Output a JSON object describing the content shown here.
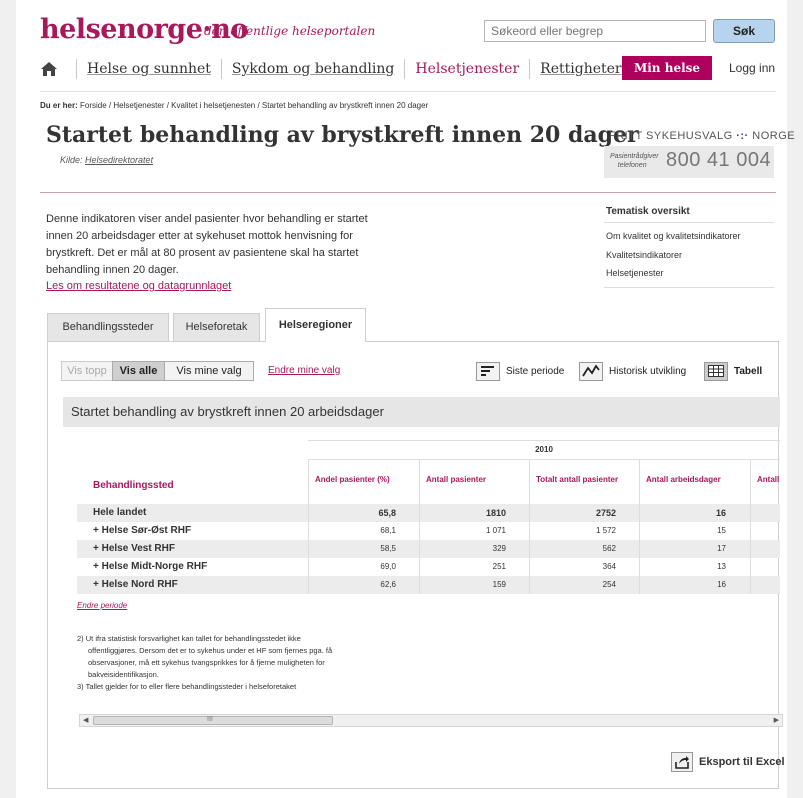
{
  "site": {
    "logo_main": "helsenorge",
    "logo_dot": "·",
    "logo_suffix": "no",
    "tagline": "den offentlige helseportalen",
    "search_placeholder": "Søkeord eller begrep",
    "search_button": "Søk"
  },
  "nav": {
    "items": [
      "Helse og sunnhet",
      "Sykdom og behandling",
      "Helsetjenester",
      "Rettigheter"
    ],
    "active_index": 2,
    "min_helse": "Min helse",
    "logg_inn": "Logg inn"
  },
  "breadcrumb": {
    "prefix": "Du er her:",
    "path": "Forside / Helsetjenester / Kvalitet i helsetjenesten / Startet behandling av brystkreft innen 20 dager"
  },
  "page": {
    "title": "Startet behandling av brystkreft innen 20 dager",
    "kilde_label": "Kilde:",
    "kilde_link": "Helsedirektoratet",
    "intro": "Denne indikatoren viser andel pasienter hvor behandling er startet innen 20 arbeidsdager etter at sykehuset mottok henvisning for brystkreft. Det er mål at 80 prosent av pasientene skal ha startet behandling innen 20 dager.",
    "intro_link": "Les om resultatene og datagrunnlaget"
  },
  "fritt_sykehusvalg": {
    "title": "FRITT SYKEHUSVALG",
    "country": "NORGE",
    "small_line1": "Pasientrådgiver",
    "small_line2": "telefonen",
    "number": "800 41 004"
  },
  "tematisk": {
    "title": "Tematisk oversikt",
    "links": [
      "Om kvalitet og kvalitetsindikatorer",
      "Kvalitetsindikatorer",
      "Helsetjenester"
    ]
  },
  "tabs": [
    "Behandlingssteder",
    "Helseforetak",
    "Helseregioner"
  ],
  "active_tab": 2,
  "toolbar": {
    "vis_topp": "Vis topp",
    "vis_alle": "Vis alle",
    "vis_mine_valg": "Vis mine valg",
    "endre_mine_valg": "Endre mine valg",
    "siste_periode": "Siste periode",
    "historisk": "Historisk utvikling",
    "tabell": "Tabell"
  },
  "table": {
    "heading": "Startet behandling av brystkreft innen 20 arbeidsdager",
    "year": "2010",
    "row_header": "Behandlingssted",
    "columns": [
      "Andel pasienter (%)",
      "Antall pasienter",
      "Totalt antall pasienter",
      "Antall arbeidsdager",
      "Antall"
    ],
    "rows": [
      {
        "name": "Hele landet",
        "values": [
          "65,8",
          "1810",
          "2752",
          "16"
        ]
      },
      {
        "name": "+ Helse Sør-Øst RHF",
        "values": [
          "68,1",
          "1 071",
          "1 572",
          "15"
        ]
      },
      {
        "name": "+ Helse Vest RHF",
        "values": [
          "58,5",
          "329",
          "562",
          "17"
        ]
      },
      {
        "name": "+ Helse Midt-Norge RHF",
        "values": [
          "69,0",
          "251",
          "364",
          "13"
        ]
      },
      {
        "name": "+ Helse Nord RHF",
        "values": [
          "62,6",
          "159",
          "254",
          "16"
        ]
      }
    ]
  },
  "endre_periode": "Endre periode",
  "notes": {
    "n2_l1": "2) Ut ifra statistisk forsvarlighet kan tallet for behandlingsstedet ikke",
    "n2_l2": "offentliggjøres. Dersom det er to sykehus under et HF som fjernes pga. få",
    "n2_l3": "observasjoner, må ett sykehus tvangsprikkes for å fjerne muligheten for",
    "n2_l4": "bakveisidentifikasjon.",
    "n3": "3) Tallet gjelder for to eller flere behandlingssteder i helseforetaket"
  },
  "scrollbar_grip": "III",
  "export_label": "Eksport til Excel"
}
